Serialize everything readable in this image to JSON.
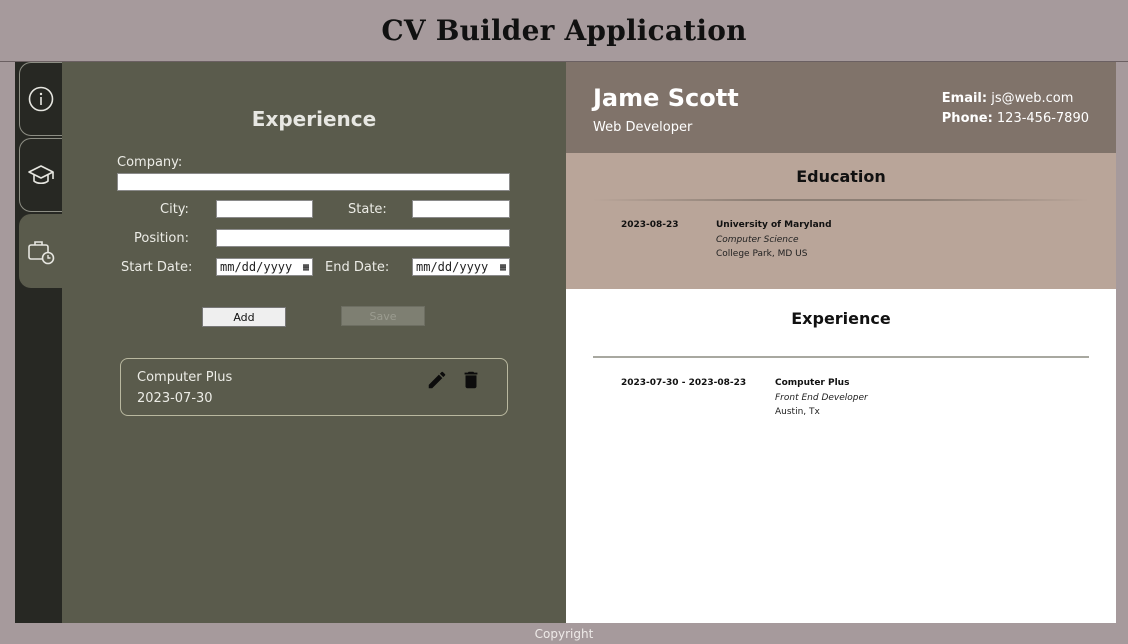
{
  "app": {
    "title": "CV Builder Application"
  },
  "sidebar": {
    "tabs": [
      {
        "name": "info",
        "icon": "info-icon"
      },
      {
        "name": "education",
        "icon": "graduation-cap-icon"
      },
      {
        "name": "experience",
        "icon": "briefcase-clock-icon",
        "active": true
      }
    ]
  },
  "form": {
    "title": "Experience",
    "company_label": "Company:",
    "company_value": "",
    "city_label": "City:",
    "city_value": "",
    "state_label": "State:",
    "state_value": "",
    "position_label": "Position:",
    "position_value": "",
    "start_label": "Start Date:",
    "start_value": "mm/dd/yyyy",
    "end_label": "End Date:",
    "end_value": "mm/dd/yyyy",
    "add_label": "Add",
    "save_label": "Save"
  },
  "entries": [
    {
      "company": "Computer Plus",
      "date": "2023-07-30"
    }
  ],
  "preview": {
    "name": "Jame Scott",
    "title": "Web Developer",
    "email_label": "Email:",
    "email": "js@web.com",
    "phone_label": "Phone:",
    "phone": "123-456-7890",
    "education": {
      "title": "Education",
      "items": [
        {
          "date": "2023-08-23",
          "institution": "University of Maryland",
          "field": "Computer Science",
          "location": "College Park, MD US"
        }
      ]
    },
    "experience": {
      "title": "Experience",
      "items": [
        {
          "date": "2023-07-30 - 2023-08-23",
          "company": "Computer Plus",
          "position": "Front End Developer",
          "location": "Austin, Tx"
        }
      ]
    }
  },
  "footer": {
    "text": "Copyright"
  },
  "colors": {
    "page_bg": "#a69a9c",
    "sidebar_bg": "#272823",
    "form_bg": "#5a5b4c",
    "cv_header_bg": "#80736a",
    "education_bg": "#b9a599"
  }
}
